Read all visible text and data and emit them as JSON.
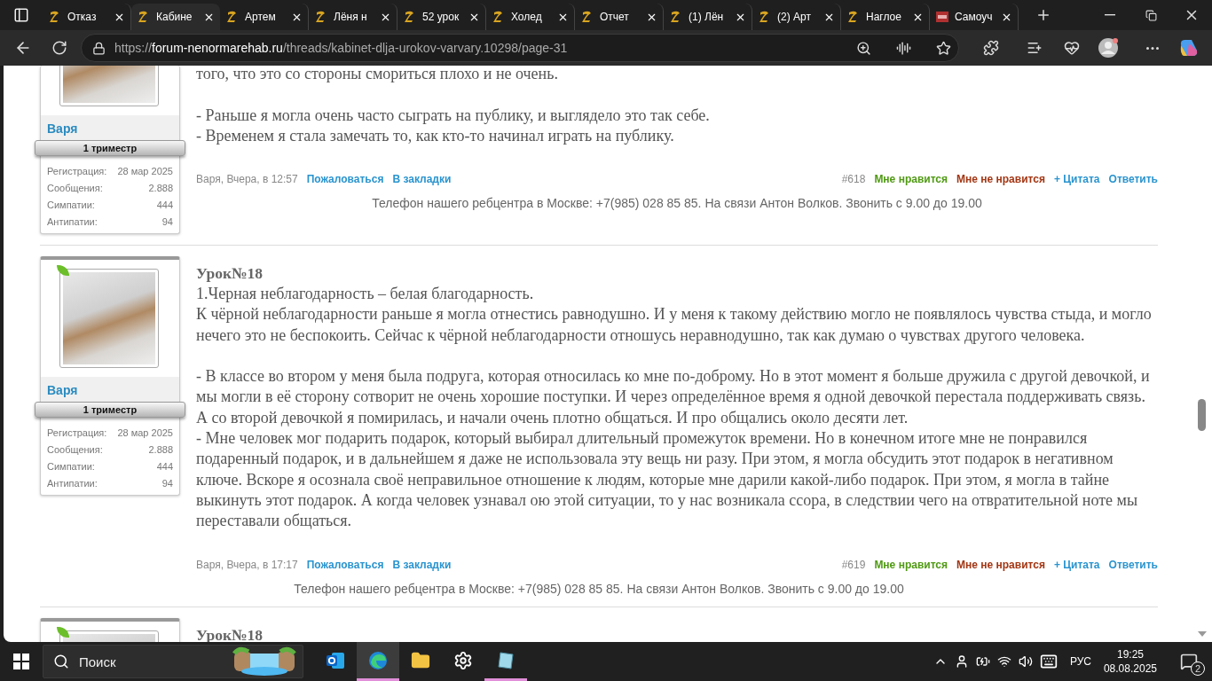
{
  "browser": {
    "tabs": [
      {
        "title": "Отказ",
        "kind": "site",
        "selected": false
      },
      {
        "title": "Кабине",
        "kind": "site",
        "selected": true
      },
      {
        "title": "Артем",
        "kind": "site",
        "selected": false
      },
      {
        "title": "Лёня н",
        "kind": "site",
        "selected": false
      },
      {
        "title": "52 урок",
        "kind": "site",
        "selected": false
      },
      {
        "title": "Холед",
        "kind": "site",
        "selected": false
      },
      {
        "title": "Отчет",
        "kind": "site",
        "selected": false
      },
      {
        "title": "(1) Лён",
        "kind": "site",
        "selected": false
      },
      {
        "title": "(2) Арт",
        "kind": "site",
        "selected": false
      },
      {
        "title": "Наглое",
        "kind": "site",
        "selected": false
      },
      {
        "title": "Самоуч",
        "kind": "pdf",
        "selected": false
      }
    ],
    "url": {
      "scheme": "https://",
      "host": "forum-nenormarehab.ru",
      "path": "/threads/kabinet-dlja-urokov-varvary.10298/page-31"
    }
  },
  "posts": [
    {
      "avatar_cut": true,
      "author": "Варя",
      "rank": "1 триместр",
      "stats": [
        {
          "label": "Регистрация:",
          "value": "28 мар 2025"
        },
        {
          "label": "Сообщения:",
          "value": "2.888"
        },
        {
          "label": "Симпатии:",
          "value": "444"
        },
        {
          "label": "Антипатии:",
          "value": "94"
        }
      ],
      "blocks": [
        [
          "того, что это со стороны смориться плохо и не очень."
        ],
        [
          "- Раньше я могла очень часто сыграть на публику, и выглядело это так себе.",
          "- Временем я стала замечать то, как кто-то начинал играть на публику."
        ]
      ],
      "meta": "Варя, Вчера, в 12:57",
      "links": [
        "Пожаловаться",
        "В закладки"
      ],
      "number": "#618",
      "actions": [
        {
          "label": "Мне нравится",
          "kind": "like"
        },
        {
          "label": "Мне не нравится",
          "kind": "dislike"
        },
        {
          "label": "+ Цитата",
          "kind": "link"
        },
        {
          "label": "Ответить",
          "kind": "link"
        }
      ],
      "phone": "Телефон нашего ребцентра в Москве: +7(985) 028 85 85. На связи Антон Волков. Звонить с 9.00 до 19.00",
      "phone_full_width": false
    },
    {
      "avatar_cut": false,
      "author": "Варя",
      "rank": "1 триместр",
      "stats": [
        {
          "label": "Регистрация:",
          "value": "28 мар 2025"
        },
        {
          "label": "Сообщения:",
          "value": "2.888"
        },
        {
          "label": "Симпатии:",
          "value": "444"
        },
        {
          "label": "Антипатии:",
          "value": "94"
        }
      ],
      "title": "Урок№18",
      "blocks": [
        [
          "1.Черная неблагодарность – белая благодарность.",
          "К чёрной неблагодарности раньше я могла отнестись равнодушно. И у меня к такому действию могло не появлялось чувства стыда, и могло нечего это не беспокоить. Сейчас к чёрной неблагодарности отношусь неравнодушно, так как думаю о чувствах другого человека."
        ],
        [
          "- В классе во втором у меня была подруга, которая относилась ко мне по-доброму. Но в этот момент я больше дружила с другой девочкой, и мы могли в её сторону сотворит не очень хорошие поступки. И через определённое время я одной девочкой перестала поддерживать связь. А со второй девочкой я помирилась, и начали очень плотно общаться. И про общались около десяти лет.",
          "- Мне человек мог подарить подарок, который выбирал длительный промежуток времени. Но в конечном итоге мне не понравился подаренный подарок, и в дальнейшем я даже не использовала эту вещь ни разу. При этом, я могла обсудить этот подарок в негативном ключе. Вскоре я осознала своё неправильное отношение к людям, которые мне дарили какой-либо подарок. При этом, я могла в тайне выкинуть этот подарок. А когда человек узнавал ою этой ситуации, то у нас возникала ссора, в следствии чего на отвратительной ноте мы переставали общаться."
        ]
      ],
      "meta": "Варя, Вчера, в 17:17",
      "links": [
        "Пожаловаться",
        "В закладки"
      ],
      "number": "#619",
      "actions": [
        {
          "label": "Мне нравится",
          "kind": "like"
        },
        {
          "label": "Мне не нравится",
          "kind": "dislike"
        },
        {
          "label": "+ Цитата",
          "kind": "link"
        },
        {
          "label": "Ответить",
          "kind": "link"
        }
      ],
      "phone": "Телефон нашего ребцентра в Москве: +7(985) 028 85 85. На связи Антон Волков. Звонить с 9.00 до 19.00",
      "phone_full_width": true
    },
    {
      "avatar_cut": false,
      "title": "Урок№18"
    }
  ],
  "taskbar": {
    "search": {
      "placeholder": "Поиск"
    },
    "apps": [
      {
        "kind": "mail",
        "selected": false,
        "running": false
      },
      {
        "kind": "browser",
        "selected": true,
        "running": true
      },
      {
        "kind": "folder",
        "selected": false,
        "running": false
      },
      {
        "kind": "settings",
        "selected": false,
        "running": false
      },
      {
        "kind": "notepad",
        "selected": false,
        "running": true
      }
    ],
    "language": "РУС",
    "time": "19:25",
    "date": "08.08.2025",
    "notifications": "2"
  }
}
